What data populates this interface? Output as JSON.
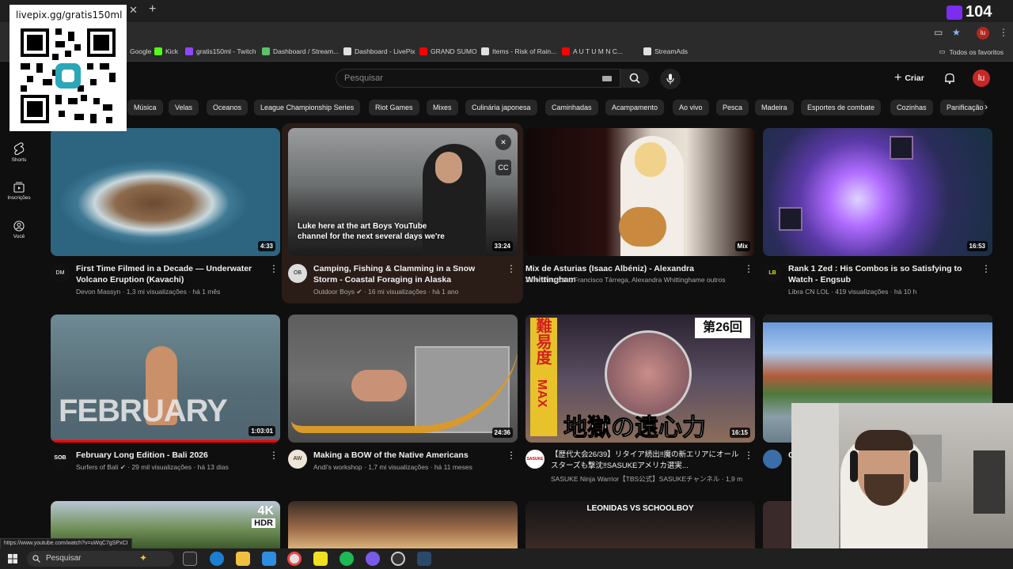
{
  "browser": {
    "tab_close_glyph": "✕",
    "new_tab_glyph": "+",
    "profile_initial": "lu",
    "bookmarks": [
      {
        "label": "Google",
        "color": "#4285f4"
      },
      {
        "label": "Kick",
        "color": "#53fc18"
      },
      {
        "label": "gratis150ml - Twitch",
        "color": "#9146ff"
      },
      {
        "label": "Dashboard / Stream...",
        "color": "#5cc16a"
      },
      {
        "label": "Dashboard - LivePix",
        "color": "#e0e0e0"
      },
      {
        "label": "GRAND SUMO",
        "color": "#ff0000"
      },
      {
        "label": "Items - Risk of Rain...",
        "color": "#e0e0e0"
      },
      {
        "label": "A U T U M N      C...",
        "color": "#ff0000"
      },
      {
        "label": "StreamAds",
        "color": "#e0e0e0"
      }
    ],
    "all_bookmarks": "Todos os favoritos",
    "status_url": "https://www.youtube.com/watch?v=uWqC7gSPxCI"
  },
  "stream_overlay": {
    "qr_url": "livepix.gg/gratis150ml",
    "viewer_count": "104"
  },
  "youtube": {
    "search_placeholder": "Pesquisar",
    "create_label": "Criar",
    "avatar_initial": "lu",
    "nav": [
      {
        "label": "Shorts",
        "icon": "shorts-icon"
      },
      {
        "label": "Inscrições",
        "icon": "subscriptions-icon"
      },
      {
        "label": "Você",
        "icon": "you-icon"
      }
    ],
    "chips": [
      "Música",
      "Velas",
      "Oceanos",
      "League Championship Series",
      "Riot Games",
      "Mixes",
      "Culinária japonesa",
      "Caminhadas",
      "Acampamento",
      "Ao vivo",
      "Pesca",
      "Madeira",
      "Esportes de combate",
      "Cozinhas",
      "Panificação"
    ],
    "videos": [
      {
        "title": "First Time Filmed in a Decade — Underwater Volcano Eruption (Kavachi)",
        "channel": "Devon Massyn",
        "views": "1,3 mi",
        "age": "há 1 mês",
        "duration": "4:33",
        "avatar": "DM"
      },
      {
        "title": "Camping, Fishing & Clamming in a Snow Storm - Coastal Foraging in Alaska",
        "channel": "Outdoor Boys",
        "views": "16 mi",
        "age": "há 1 ano",
        "duration": "33:24",
        "avatar": "OB",
        "caption": "Luke here at the art Boys YouTube channel for the next several days we're"
      },
      {
        "title": "Mix de Asturias (Isaac Albéniz) - Alexandra Whittingham",
        "channel": "Astor Piazzolla, Francisco Tárrega, Alexandra Whittinghame outros",
        "views": "",
        "age": "",
        "duration": "Mix",
        "avatar": ""
      },
      {
        "title": "Rank 1 Zed : His Combos is so Satisfying to Watch - Engsub",
        "channel": "Libra CN LOL",
        "views": "419",
        "age": "há 10 h",
        "duration": "16:53",
        "avatar": "LB"
      },
      {
        "title": "February Long Edition - Bali 2026",
        "channel": "Surfers of Bali",
        "views": "29 mil",
        "age": "há 13 dias",
        "duration": "1:03:01",
        "avatar": "SOB"
      },
      {
        "title": "Making a BOW of the Native Americans",
        "channel": "Andi's workshop",
        "views": "1,7 mi",
        "age": "há 11 meses",
        "duration": "24:36",
        "avatar": "AW"
      },
      {
        "title": "【歴代大会26/39】リタイア続出‼魔の新エリアにオールスターズも撃沈‼SASUKEアメリカ選実...",
        "channel": "SASUKE Ninja Warrior【TBS公式】SASUKEチャンネル",
        "views": "1,9 m",
        "age": "",
        "duration": "16:15",
        "avatar": "SASUKE"
      },
      {
        "title": "C",
        "channel": "",
        "views": "",
        "age": "",
        "duration": "",
        "avatar": ""
      }
    ],
    "row3_labels": {
      "hdr": "HDR",
      "fourk": "4K",
      "leonidas": "LEONIDAS VS SCHOOLBOY"
    },
    "thumb_text": {
      "february": "FEBRUARY",
      "sasuke_kanji": "難易度",
      "sasuke_max": "MAX",
      "sasuke_episode": "第26回",
      "sasuke_bottom": "地獄の遠心力"
    }
  },
  "taskbar": {
    "search_label": "Pesquisar"
  }
}
